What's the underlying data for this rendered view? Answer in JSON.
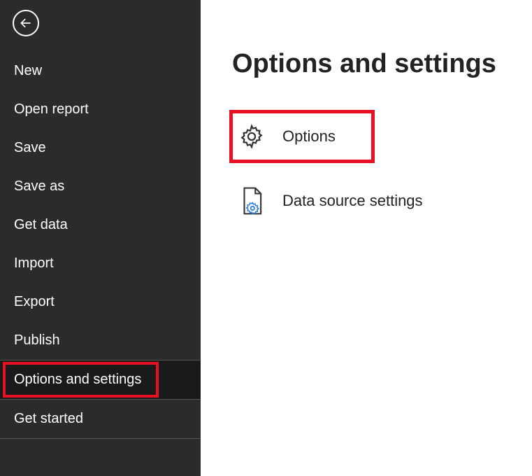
{
  "sidebar": {
    "items": [
      {
        "label": "New"
      },
      {
        "label": "Open report"
      },
      {
        "label": "Save"
      },
      {
        "label": "Save as"
      },
      {
        "label": "Get data"
      },
      {
        "label": "Import"
      },
      {
        "label": "Export"
      },
      {
        "label": "Publish"
      },
      {
        "label": "Options and settings",
        "selected": true,
        "highlighted": true
      },
      {
        "label": "Get started"
      }
    ]
  },
  "main": {
    "title": "Options and settings",
    "options": [
      {
        "label": "Options",
        "icon": "gear-icon",
        "highlighted": true
      },
      {
        "label": "Data source settings",
        "icon": "file-gear-icon"
      }
    ]
  }
}
